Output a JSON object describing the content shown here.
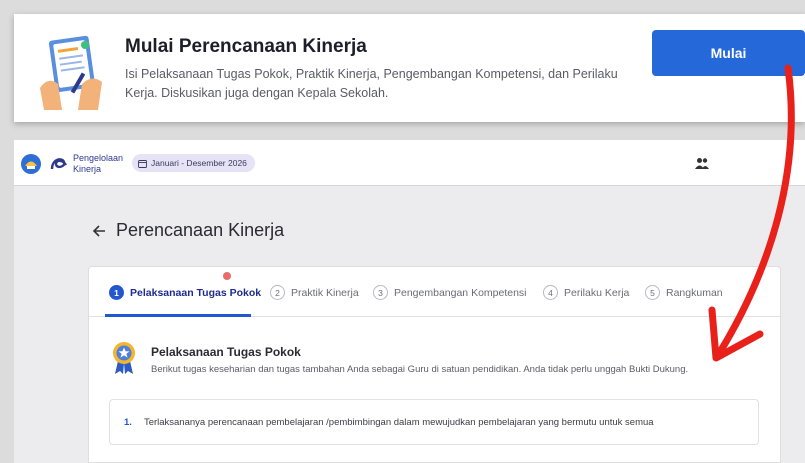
{
  "callout": {
    "title": "Mulai Perencanaan Kinerja",
    "description": "Isi Pelaksanaan Tugas Pokok, Praktik Kinerja, Pengembangan Kompetensi, dan Perilaku Kerja. Diskusikan juga dengan Kepala Sekolah.",
    "button_label": "Mulai",
    "accent_color": "#2468d9"
  },
  "topbar": {
    "brand_line1": "Pengelolaan",
    "brand_line2": "Kinerja",
    "period": "Januari - Desember 2026",
    "icons": [
      "emblem-logo-icon",
      "pengelolaan-kinerja-logo-icon",
      "calendar-icon",
      "people-icon"
    ]
  },
  "page": {
    "title": "Perencanaan Kinerja"
  },
  "tabs": [
    {
      "num": "1",
      "label": "Pelaksanaan Tugas Pokok",
      "active": true
    },
    {
      "num": "2",
      "label": "Praktik Kinerja",
      "active": false
    },
    {
      "num": "3",
      "label": "Pengembangan Kompetensi",
      "active": false
    },
    {
      "num": "4",
      "label": "Perilaku Kerja",
      "active": false
    },
    {
      "num": "5",
      "label": "Rangkuman",
      "active": false
    }
  ],
  "section": {
    "title": "Pelaksanaan Tugas Pokok",
    "description": "Berikut tugas keseharian dan tugas tambahan Anda sebagai Guru di satuan pendidikan. Anda tidak perlu unggah Bukti Dukung."
  },
  "items": [
    {
      "num": "1.",
      "text": "Terlaksananya perencanaan pembelajaran /pembimbingan dalam mewujudkan pembelajaran yang bermutu untuk semua"
    }
  ],
  "annotation_color": "#e8221b"
}
